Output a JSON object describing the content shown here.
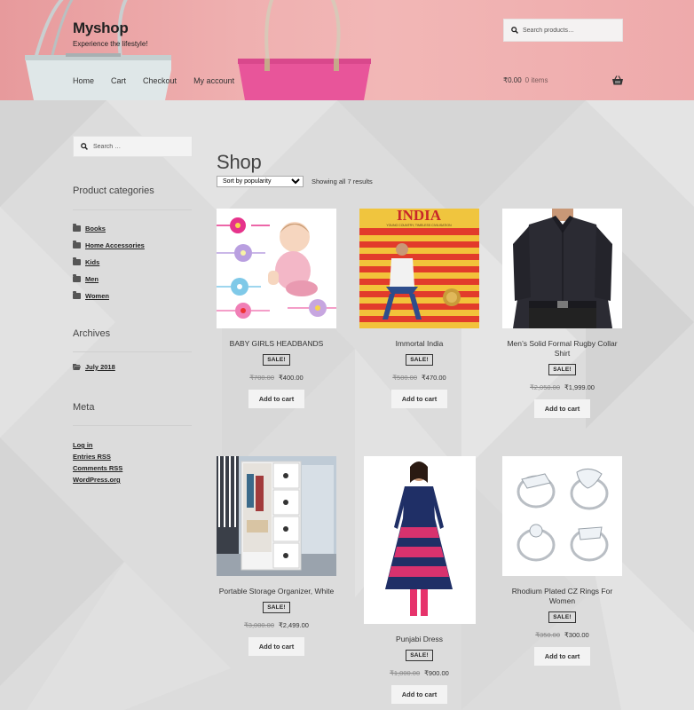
{
  "site": {
    "title": "Myshop",
    "tagline": "Experience the lifestyle!"
  },
  "nav": {
    "items": [
      {
        "label": "Home"
      },
      {
        "label": "Cart"
      },
      {
        "label": "Checkout"
      },
      {
        "label": "My account"
      }
    ]
  },
  "header_search": {
    "placeholder": "Search products…"
  },
  "cart": {
    "total": "₹0.00",
    "items": "0 items"
  },
  "sidebar": {
    "search_placeholder": "Search …",
    "categories_title": "Product categories",
    "categories": [
      "Books",
      "Home Accessories",
      "Kids",
      "Men",
      "Women"
    ],
    "archives_title": "Archives",
    "archives": [
      "July 2018"
    ],
    "meta_title": "Meta",
    "meta": [
      "Log in",
      "Entries RSS",
      "Comments RSS",
      "WordPress.org"
    ]
  },
  "main": {
    "title": "Shop",
    "sort_selected": "Sort by popularity",
    "result_count": "Showing all 7 results",
    "sale_label": "SALE!",
    "add_to_cart": "Add to cart",
    "products": [
      {
        "name": "BABY GIRLS HEADBANDS",
        "old_price": "₹700.00",
        "price": "₹400.00",
        "image": "baby-headbands-image"
      },
      {
        "name": "Immortal India",
        "old_price": "₹500.00",
        "price": "₹470.00",
        "image": "book-cover-image",
        "cover_title": "INDIA",
        "cover_subtitle": "YOUNG COUNTRY, TIMELESS CIVILISATION"
      },
      {
        "name": "Men’s Solid Formal Rugby Collar Shirt",
        "old_price": "₹2,050.00",
        "price": "₹1,999.00",
        "image": "mens-shirt-image"
      },
      {
        "name": "Portable Storage Organizer, White",
        "old_price": "₹3,000.00",
        "price": "₹2,499.00",
        "image": "storage-organizer-image"
      },
      {
        "name": "Punjabi Dress",
        "old_price": "₹1,000.00",
        "price": "₹900.00",
        "image": "punjabi-dress-image"
      },
      {
        "name": "Rhodium Plated CZ Rings For Women",
        "old_price": "₹350.00",
        "price": "₹300.00",
        "image": "rings-image"
      }
    ]
  },
  "colors": {
    "header_pink": "#efb0b0",
    "page_grey": "#dedede",
    "text": "#333333"
  }
}
